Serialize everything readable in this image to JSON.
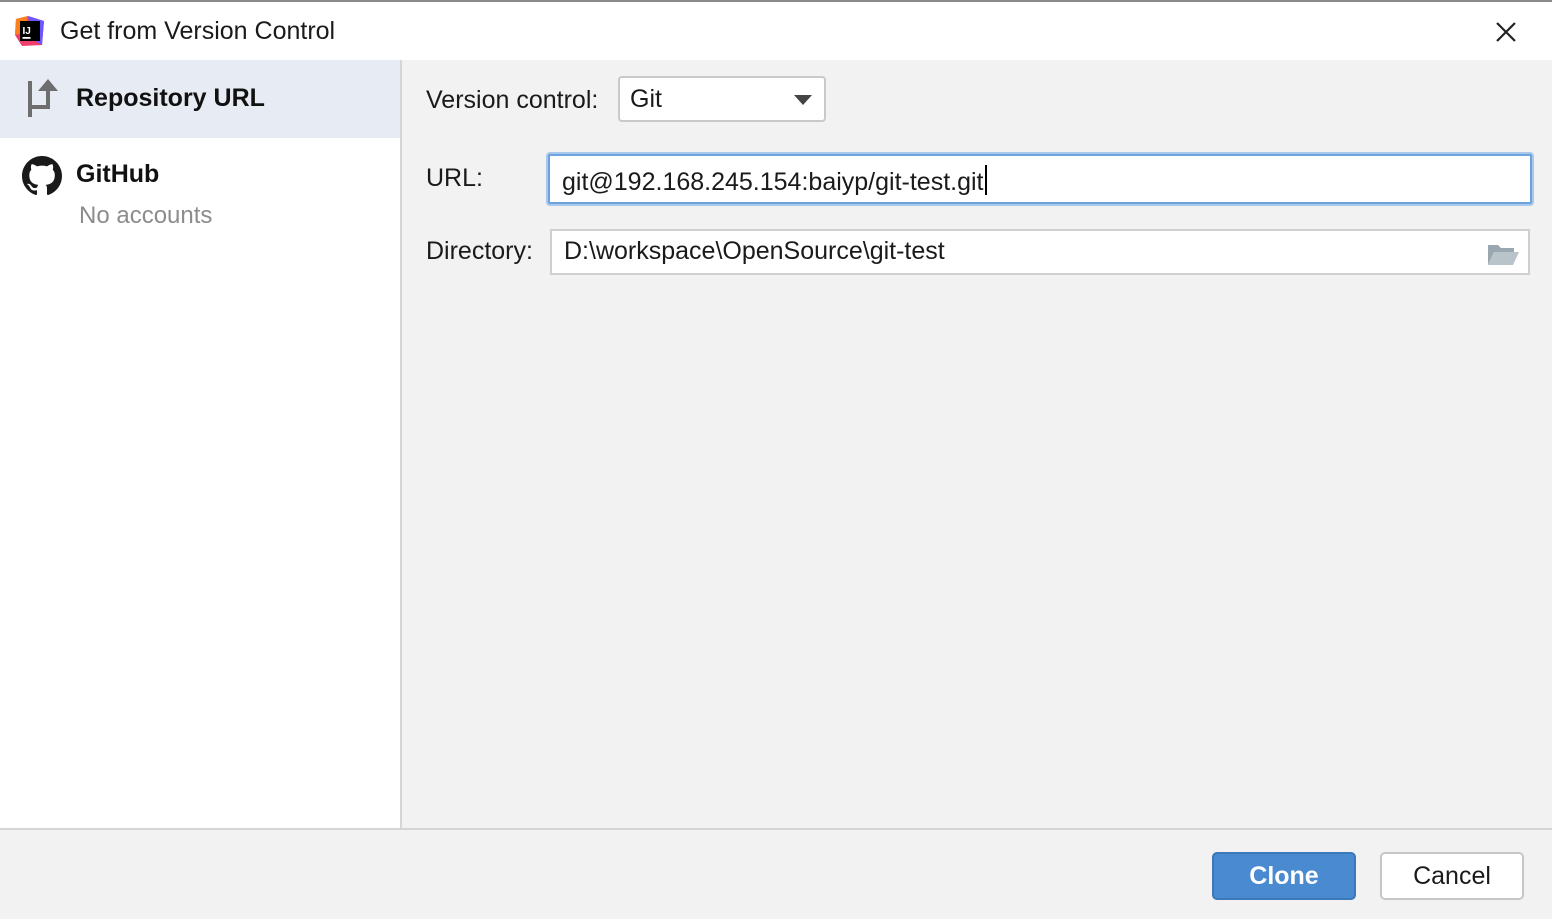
{
  "window": {
    "title": "Get from Version Control",
    "app_icon": "intellij-idea-icon",
    "close_icon": "close-icon"
  },
  "sidebar": {
    "items": [
      {
        "label": "Repository URL",
        "icon": "repository-url-icon",
        "selected": true
      },
      {
        "label": "GitHub",
        "sublabel": "No accounts",
        "icon": "github-icon",
        "selected": false
      }
    ]
  },
  "form": {
    "version_control": {
      "label": "Version control:",
      "value": "Git"
    },
    "url": {
      "label": "URL:",
      "value": "git@192.168.245.154:baiyp/git-test.git"
    },
    "directory": {
      "label": "Directory:",
      "value": "D:\\workspace\\OpenSource\\git-test",
      "browse_icon": "folder-open-icon"
    }
  },
  "footer": {
    "clone_label": "Clone",
    "cancel_label": "Cancel"
  },
  "colors": {
    "accent": "#4a8ad0",
    "focus_border": "#6ea2dc",
    "selected_row": "#e7ecf4",
    "muted_text": "#8c8c8c"
  }
}
